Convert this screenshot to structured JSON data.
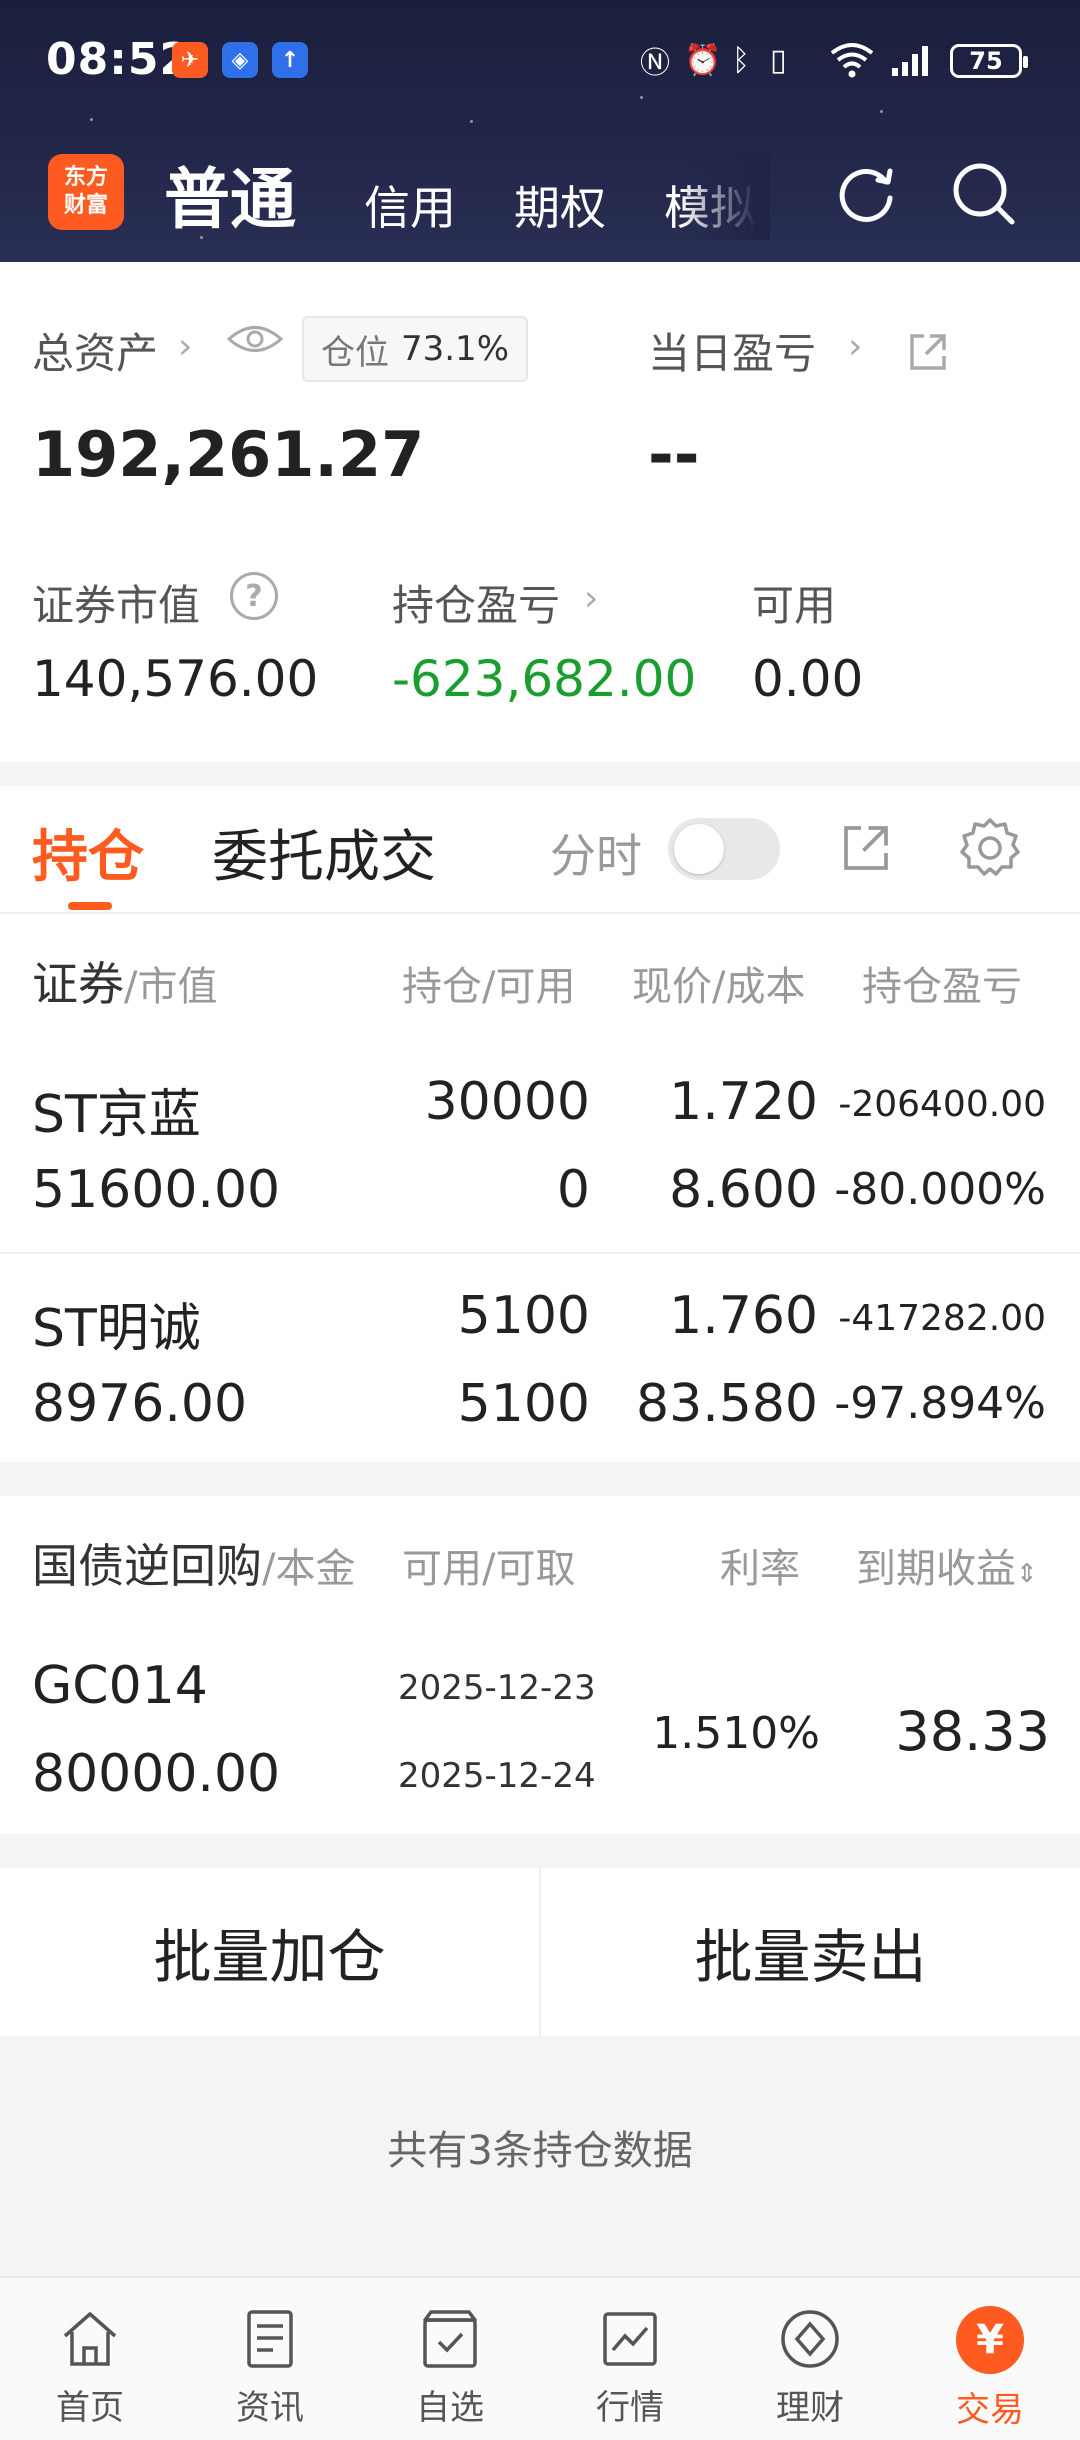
{
  "status_bar": {
    "time": "08:52",
    "battery": "75"
  },
  "header": {
    "logo_line1": "东方",
    "logo_line2": "财富",
    "tabs": [
      "普通",
      "信用",
      "期权",
      "模拟"
    ],
    "active_tab": "普通"
  },
  "assets": {
    "total_label": "总资产",
    "position_label": "仓位",
    "position_value": "73.1%",
    "total_value": "192,261.27",
    "daily_pnl_label": "当日盈亏",
    "daily_pnl_value": "--",
    "market_value_label": "证券市值",
    "market_value": "140,576.00",
    "holding_pnl_label": "持仓盈亏",
    "holding_pnl": "-623,682.00",
    "available_label": "可用",
    "available": "0.00"
  },
  "holdings": {
    "tab_positions": "持仓",
    "tab_orders": "委托成交",
    "timeshare_label": "分时",
    "headers": {
      "security": "证券",
      "market_value": "/市值",
      "qty": "持仓/可用",
      "price": "现价/成本",
      "pnl": "持仓盈亏"
    },
    "rows": [
      {
        "name": "ST京蓝",
        "value": "51600.00",
        "qty": "30000",
        "avail": "0",
        "price": "1.720",
        "cost": "8.600",
        "pnl": "-206400.00",
        "pnl_pct": "-80.000%"
      },
      {
        "name": "ST明诚",
        "value": "8976.00",
        "qty": "5100",
        "avail": "5100",
        "price": "1.760",
        "cost": "83.580",
        "pnl": "-417282.00",
        "pnl_pct": "-97.894%"
      }
    ]
  },
  "repo": {
    "headers": {
      "title": "国债逆回购",
      "principal": "/本金",
      "avail": "可用/可取",
      "rate": "利率",
      "yield": "到期收益"
    },
    "row": {
      "code": "GC014",
      "principal": "80000.00",
      "date1": "2025-12-23",
      "date2": "2025-12-24",
      "rate": "1.510%",
      "yield": "38.33"
    }
  },
  "actions": {
    "batch_add": "批量加仓",
    "batch_sell": "批量卖出"
  },
  "footnote": "共有3条持仓数据",
  "bottom_nav": [
    {
      "label": "首页",
      "icon": "home-icon"
    },
    {
      "label": "资讯",
      "icon": "news-icon"
    },
    {
      "label": "自选",
      "icon": "watchlist-icon"
    },
    {
      "label": "行情",
      "icon": "market-icon"
    },
    {
      "label": "理财",
      "icon": "wealth-icon"
    },
    {
      "label": "交易",
      "icon": "trade-icon"
    }
  ],
  "colors": {
    "accent": "#ff5a1f",
    "loss_green": "#1a9f2f",
    "gain_red": "#e0303a"
  }
}
